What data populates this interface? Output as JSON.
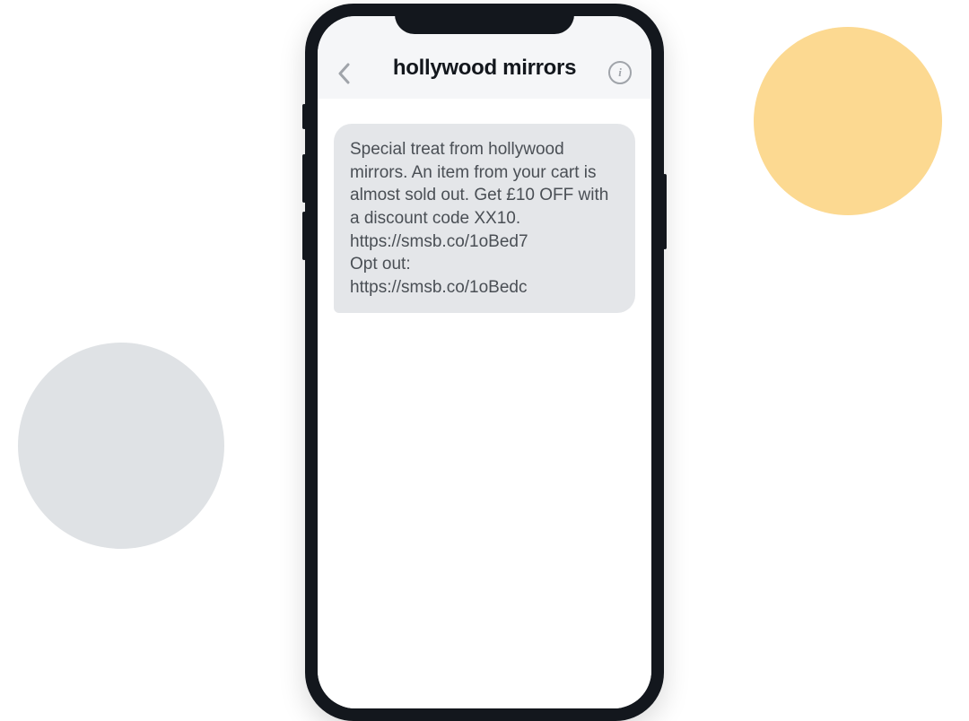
{
  "header": {
    "title": "hollywood mirrors",
    "info_glyph": "i"
  },
  "message": {
    "text": "Special treat from hollywood mirrors. An item from your cart is almost sold out. Get £10 OFF with a discount code XX10.\nhttps://smsb.co/1oBed7\nOpt out:\nhttps://smsb.co/1oBedc"
  },
  "decor": {
    "yellow": "#fcd991",
    "grey": "#dfe2e5"
  }
}
